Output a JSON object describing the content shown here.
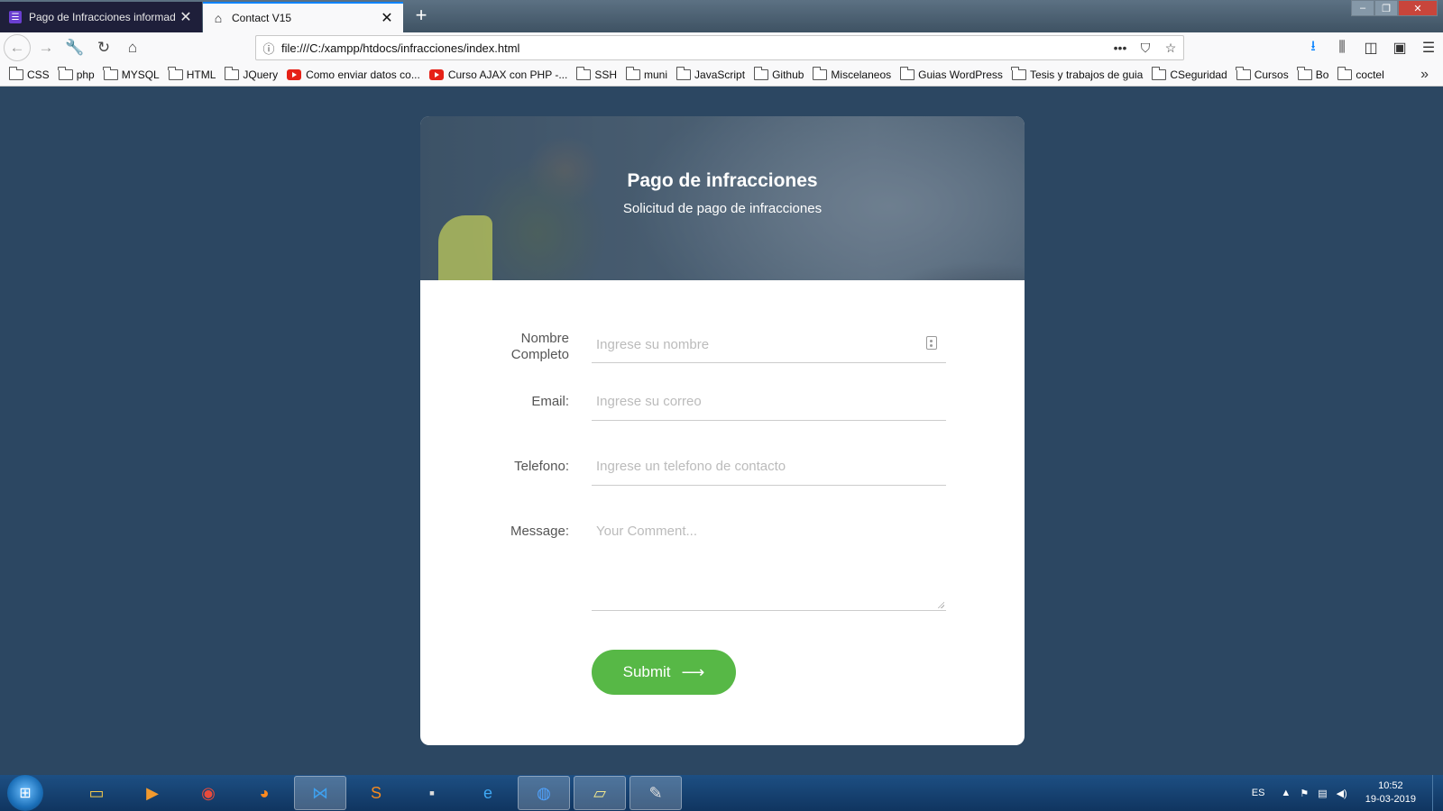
{
  "browser": {
    "tabs": [
      {
        "label": "Pago de Infracciones informad",
        "icon": "list-icon",
        "active": false
      },
      {
        "label": "Contact V15",
        "icon": "home-icon",
        "active": true
      }
    ],
    "url": "file:///C:/xampp/htdocs/infracciones/index.html",
    "bookmarks": [
      {
        "label": "CSS",
        "type": "folder"
      },
      {
        "label": "php",
        "type": "folder"
      },
      {
        "label": "MYSQL",
        "type": "folder"
      },
      {
        "label": "HTML",
        "type": "folder"
      },
      {
        "label": "JQuery",
        "type": "folder"
      },
      {
        "label": "Como enviar datos co...",
        "type": "youtube"
      },
      {
        "label": "Curso AJAX con PHP -...",
        "type": "youtube"
      },
      {
        "label": "SSH",
        "type": "folder"
      },
      {
        "label": "muni",
        "type": "folder"
      },
      {
        "label": "JavaScript",
        "type": "folder"
      },
      {
        "label": "Github",
        "type": "folder"
      },
      {
        "label": "Miscelaneos",
        "type": "folder"
      },
      {
        "label": "Guias WordPress",
        "type": "folder"
      },
      {
        "label": "Tesis y trabajos de guia",
        "type": "folder"
      },
      {
        "label": "CSeguridad",
        "type": "folder"
      },
      {
        "label": "Cursos",
        "type": "folder"
      },
      {
        "label": "Bo",
        "type": "folder"
      },
      {
        "label": "coctel",
        "type": "folder"
      }
    ]
  },
  "form": {
    "title": "Pago de infracciones",
    "subtitle": "Solicitud de pago de infracciones",
    "fields": {
      "name": {
        "label_line1": "Nombre",
        "label_line2": "Completo",
        "placeholder": "Ingrese su nombre"
      },
      "email": {
        "label": "Email:",
        "placeholder": "Ingrese su correo"
      },
      "phone": {
        "label": "Telefono:",
        "placeholder": "Ingrese un telefono de contacto"
      },
      "message": {
        "label": "Message:",
        "placeholder": "Your Comment..."
      }
    },
    "submit_label": "Submit",
    "colors": {
      "background": "#2c4762",
      "submit": "#57b846"
    }
  },
  "taskbar": {
    "apps": [
      "file-explorer-icon",
      "media-player-icon",
      "chrome-icon",
      "firefox-icon",
      "vscode-icon",
      "sublime-icon",
      "cmd-icon",
      "ie-icon",
      "firefox-dev-icon",
      "notes-icon",
      "paint-icon"
    ],
    "language": "ES",
    "time": "10:52",
    "date": "19-03-2019"
  }
}
